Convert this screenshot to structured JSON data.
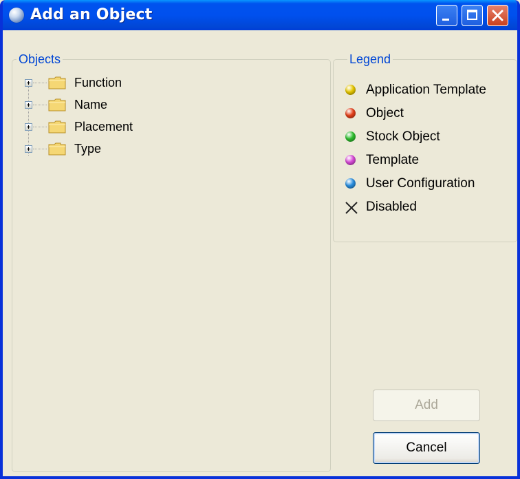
{
  "window": {
    "title": "Add an Object",
    "icons": {
      "app": "app-globe-icon",
      "minimize": "minimize-icon",
      "maximize": "maximize-icon",
      "close": "close-icon"
    }
  },
  "objects": {
    "label": "Objects",
    "tree": [
      {
        "label": "Function",
        "icon": "folder-icon",
        "expander": "plus"
      },
      {
        "label": "Name",
        "icon": "folder-icon",
        "expander": "plus"
      },
      {
        "label": "Placement",
        "icon": "folder-icon",
        "expander": "plus"
      },
      {
        "label": "Type",
        "icon": "folder-icon",
        "expander": "plus"
      }
    ]
  },
  "legend": {
    "label": "Legend",
    "items": [
      {
        "label": "Application Template",
        "color": "#e8c800"
      },
      {
        "label": "Object",
        "color": "#e6401a"
      },
      {
        "label": "Stock Object",
        "color": "#2fbf2f"
      },
      {
        "label": "Template",
        "color": "#d84ad8"
      },
      {
        "label": "User Configuration",
        "color": "#2a8fe0"
      },
      {
        "label": "Disabled",
        "icon": "x-icon"
      }
    ]
  },
  "buttons": {
    "add": "Add",
    "cancel": "Cancel"
  }
}
